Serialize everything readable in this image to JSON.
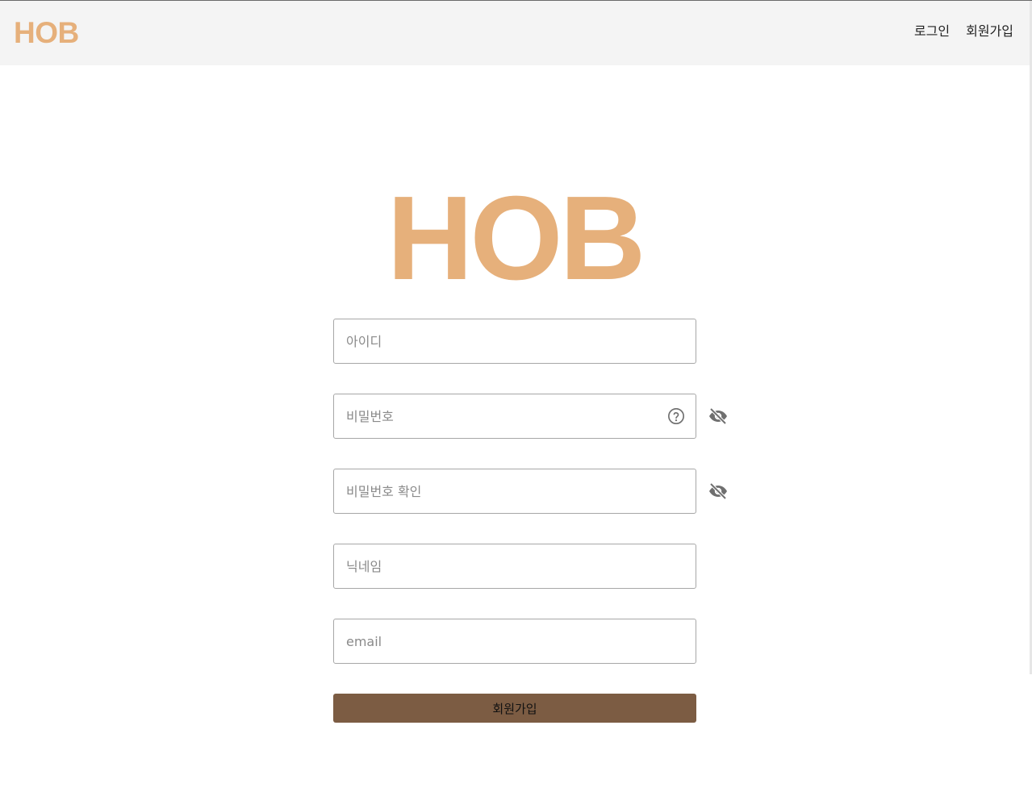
{
  "colors": {
    "brand": "#e6b07b",
    "button_bg": "#7c5c43",
    "header_bg": "#f4f4f4",
    "icon": "#6f6f6f"
  },
  "header": {
    "logo": "HOB",
    "nav": {
      "login": "로그인",
      "signup": "회원가입"
    }
  },
  "main": {
    "logo": "HOB",
    "fields": {
      "id": {
        "placeholder": "아이디",
        "value": ""
      },
      "password": {
        "placeholder": "비밀번호",
        "value": ""
      },
      "password_confirm": {
        "placeholder": "비밀번호 확인",
        "value": ""
      },
      "nickname": {
        "placeholder": "닉네임",
        "value": ""
      },
      "email": {
        "placeholder": "email",
        "value": ""
      }
    },
    "icons": {
      "help": "help-circle-icon",
      "visibility": "eye-off-icon"
    },
    "submit_label": "회원가입"
  }
}
